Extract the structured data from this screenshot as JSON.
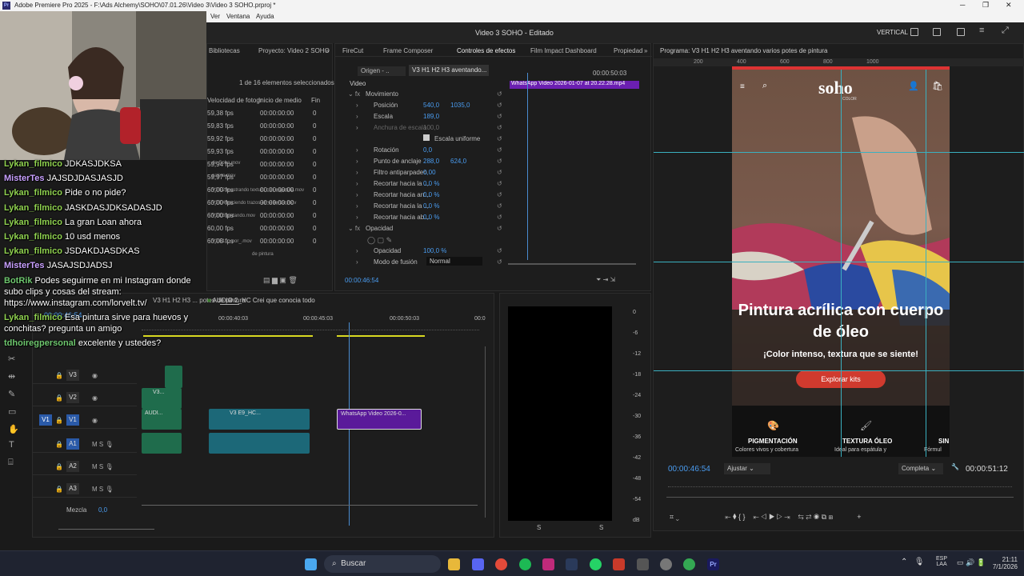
{
  "titlebar": {
    "title": "Adobe Premiere Pro 2025 - F:\\Ads Alchemy\\SOHO\\07.01.26\\Video 3\\Video 3 SOHO.prproj *"
  },
  "menu": [
    "Ver",
    "Ventana",
    "Ayuda"
  ],
  "header": {
    "center": "Video 3 SOHO - Editado",
    "layout": "VERTICAL"
  },
  "project": {
    "tabs": [
      "Bibliotecas",
      "Proyecto: Video 2 SOHO"
    ],
    "selection": "1 de 16 elementos seleccionados",
    "columns": [
      "Velocidad de fotogr",
      "Inicio de medio",
      "Fin"
    ],
    "rows": [
      {
        "fps": "59,38 fps",
        "start": "00:00:00:00",
        "end": "0"
      },
      {
        "fps": "59,83 fps",
        "start": "00:00:00:00",
        "end": "0"
      },
      {
        "fps": "59,92 fps",
        "start": "00:00:00:00",
        "end": "0"
      },
      {
        "fps": "59,93 fps",
        "start": "00:00:00:00",
        "end": "0"
      },
      {
        "fps": "59,94 fps",
        "start": "00:00:00:00",
        "end": "0"
      },
      {
        "fps": "59,97 fps",
        "start": "00:00:00:00",
        "end": "0"
      },
      {
        "fps": "60,00 fps",
        "start": "00:00:00:00",
        "end": "0"
      },
      {
        "fps": "60,00 fps",
        "start": "00:00:00:00",
        "end": "0"
      },
      {
        "fps": "60,00 fps",
        "start": "00:00:00:00",
        "end": "0"
      },
      {
        "fps": "60,00 fps",
        "start": "00:00:00:00",
        "end": "0"
      },
      {
        "fps": "60,08 fps",
        "start": "00:00:00:00",
        "end": "0"
      }
    ],
    "names": [
      "de Soho.mov",
      "paleta.mov",
      "V3 E2 mostrando textura con espatula.mov",
      "V3 E4 haciendo trazos en el lienzo.mov",
      "V3 E6 pintando.mov",
      "V3 E1 ... por_.mov",
      "de pintura"
    ]
  },
  "effects": {
    "tabs": [
      "FireCut",
      "Frame Composer",
      "Controles de efectos",
      "Film Impact Dashboard",
      "Propiedad"
    ],
    "source": "Origen - ..",
    "clip": "V3 H1 H2 H3 aventando...",
    "tc_top": "00:00:50:03",
    "clip_bar": "WhatsApp Video 2026-01-07 at 20.22.28.mp4",
    "section_video": "Video",
    "props": [
      {
        "name": "Movimiento",
        "v1": "",
        "v2": ""
      },
      {
        "name": "Posición",
        "v1": "540,0",
        "v2": "1035,0"
      },
      {
        "name": "Escala",
        "v1": "189,0",
        "v2": ""
      },
      {
        "name": "Anchura de escala",
        "v1": "100,0",
        "v2": ""
      },
      {
        "name": "Escala uniforme",
        "v1": "",
        "v2": ""
      },
      {
        "name": "Rotación",
        "v1": "0,0",
        "v2": ""
      },
      {
        "name": "Punto de anclaje",
        "v1": "288,0",
        "v2": "624,0"
      },
      {
        "name": "Filtro antiparpadeo",
        "v1": "0,00",
        "v2": ""
      },
      {
        "name": "Recortar hacia la ...",
        "v1": "0,0 %",
        "v2": ""
      },
      {
        "name": "Recortar hacia arr...",
        "v1": "0,0 %",
        "v2": ""
      },
      {
        "name": "Recortar hacia la ...",
        "v1": "0,0 %",
        "v2": ""
      },
      {
        "name": "Recortar hacia ab...",
        "v1": "0,0 %",
        "v2": ""
      },
      {
        "name": "Opacidad",
        "v1": "",
        "v2": ""
      },
      {
        "name": "Opacidad",
        "v1": "100,0 %",
        "v2": ""
      },
      {
        "name": "Modo de fusión",
        "v1": "Normal",
        "v2": ""
      }
    ],
    "timecode": "00:00:46:54"
  },
  "program": {
    "title": "Programa: V3 H1 H2 H3 aventando varios potes de pintura",
    "ruler": [
      "200",
      "400",
      "600",
      "800",
      "1000"
    ],
    "site": {
      "logo": "soho",
      "logo_sub": "COLOR",
      "headline": "Pintura acrílica con cuerpo de óleo",
      "sub": "¡Color intenso, textura que se siente!",
      "cta": "Explorar kits",
      "features": [
        {
          "title": "PIGMENTACIÓN",
          "desc": "Colores vivos y cobertura"
        },
        {
          "title": "TEXTURA ÓLEO",
          "desc": "Ideal para espátula y"
        },
        {
          "title": "SIN",
          "desc": "Fórmul"
        }
      ]
    },
    "tc_left": "00:00:46:54",
    "fit": "Ajustar",
    "quality": "Completa",
    "tc_right": "00:00:51:12"
  },
  "timeline": {
    "tab": "V3 H1 H2 H3 ... potes de pintura",
    "tab2": "AUDIO 2_HC Crei que conocia todo",
    "tc": "00:00:46:54",
    "ticks": [
      "00:00:40:03",
      "00:00:45:03",
      "00:00:50:03",
      "00:0"
    ],
    "tracks": [
      "V3",
      "V2",
      "V1",
      "A1",
      "A2",
      "A3"
    ],
    "mix": "Mezcla",
    "mix_val": "0,0",
    "clips": {
      "v2": "V3...",
      "v1a": "AUDI...",
      "v1b": "V3 E9_HC...",
      "v1c": "WhatsApp Video 2026-0..."
    }
  },
  "meter": {
    "scale": [
      "0",
      "-6",
      "-12",
      "-18",
      "-24",
      "-30",
      "-36",
      "-42",
      "-48",
      "-54",
      "dB"
    ],
    "ch": [
      "S",
      "S"
    ]
  },
  "chat": [
    {
      "user": "Lykan_filmico",
      "msg": "JDKASJDKSA",
      "c": "u1"
    },
    {
      "user": "MisterTes",
      "msg": "JAJSDJDASJASJD",
      "c": "u2"
    },
    {
      "user": "Lykan_filmico",
      "msg": "Pide o no pide?",
      "c": "u1"
    },
    {
      "user": "Lykan_filmico",
      "msg": "JASKDASJDKSADASJD",
      "c": "u1"
    },
    {
      "user": "Lykan_filmico",
      "msg": "La gran Loan ahora",
      "c": "u1"
    },
    {
      "user": "Lykan_filmico",
      "msg": "10 usd menos",
      "c": "u1"
    },
    {
      "user": "Lykan_filmico",
      "msg": "JSDAKDJASDKAS",
      "c": "u1"
    },
    {
      "user": "MisterTes",
      "msg": "JASAJSDJADSJ",
      "c": "u2"
    },
    {
      "user": "BotRik",
      "msg": "Podes seguirme en mi Instagram donde",
      "c": "u3"
    },
    {
      "user": "",
      "msg": "subo clips y cosas del stream:",
      "c": ""
    },
    {
      "user": "",
      "msg": "https://www.instagram.com/lorvelt.tv/",
      "c": ""
    },
    {
      "user": "Lykan_filmico",
      "msg": "Esa pintura sirve para huevos y",
      "c": "u1"
    },
    {
      "user": "",
      "msg": "conchitas? pregunta un amigo",
      "c": ""
    },
    {
      "user": "tdhoiregpersonal",
      "msg": "excelente y ustedes?",
      "c": "u3"
    }
  ],
  "taskbar": {
    "search": "Buscar",
    "lang1": "ESP",
    "lang2": "LAA",
    "time": "21:11",
    "date": "7/1/2026"
  }
}
